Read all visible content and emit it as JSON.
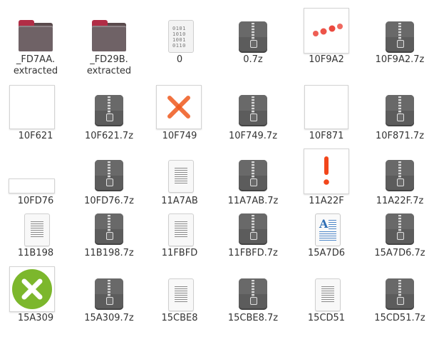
{
  "items": [
    {
      "name": "_FD7AA.\nextracted",
      "label_l1": "_FD7AA.",
      "label_l2": "extracted",
      "type": "folder"
    },
    {
      "name": "_FD29B.\nextracted",
      "label_l1": "_FD29B.",
      "label_l2": "extracted",
      "type": "folder"
    },
    {
      "label": "0",
      "type": "binary",
      "bits": "0101\n1010\n1001\n0110"
    },
    {
      "label": "0.7z",
      "type": "archive"
    },
    {
      "label": "10F9A2",
      "type": "image",
      "image_desc": "three red dots"
    },
    {
      "label": "10F9A2.7z",
      "type": "archive"
    },
    {
      "label": "10F621",
      "type": "image",
      "image_desc": "blank"
    },
    {
      "label": "10F621.7z",
      "type": "archive"
    },
    {
      "label": "10F749",
      "type": "image",
      "image_desc": "red x"
    },
    {
      "label": "10F749.7z",
      "type": "archive"
    },
    {
      "label": "10F871",
      "type": "image",
      "image_desc": "blank"
    },
    {
      "label": "10F871.7z",
      "type": "archive"
    },
    {
      "label": "10FD76",
      "type": "image",
      "image_desc": "blank wide"
    },
    {
      "label": "10FD76.7z",
      "type": "archive"
    },
    {
      "label": "11A7AB",
      "type": "text"
    },
    {
      "label": "11A7AB.7z",
      "type": "archive"
    },
    {
      "label": "11A22F",
      "type": "image",
      "image_desc": "red exclamation"
    },
    {
      "label": "11A22F.7z",
      "type": "archive"
    },
    {
      "label": "11B198",
      "type": "text"
    },
    {
      "label": "11B198.7z",
      "type": "archive"
    },
    {
      "label": "11FBFD",
      "type": "text"
    },
    {
      "label": "11FBFD.7z",
      "type": "archive"
    },
    {
      "label": "15A7D6",
      "type": "richtext"
    },
    {
      "label": "15A7D6.7z",
      "type": "archive"
    },
    {
      "label": "15A309",
      "type": "image",
      "image_desc": "green circle with white x"
    },
    {
      "label": "15A309.7z",
      "type": "archive"
    },
    {
      "label": "15CBE8",
      "type": "text"
    },
    {
      "label": "15CBE8.7z",
      "type": "archive"
    },
    {
      "label": "15CD51",
      "type": "text"
    },
    {
      "label": "15CD51.7z",
      "type": "archive"
    }
  ],
  "colors": {
    "folder_tab": "#b12d46",
    "archive": "#5c5c5c",
    "red_mark": "#e8291c",
    "green_badge": "#7cb72c"
  }
}
